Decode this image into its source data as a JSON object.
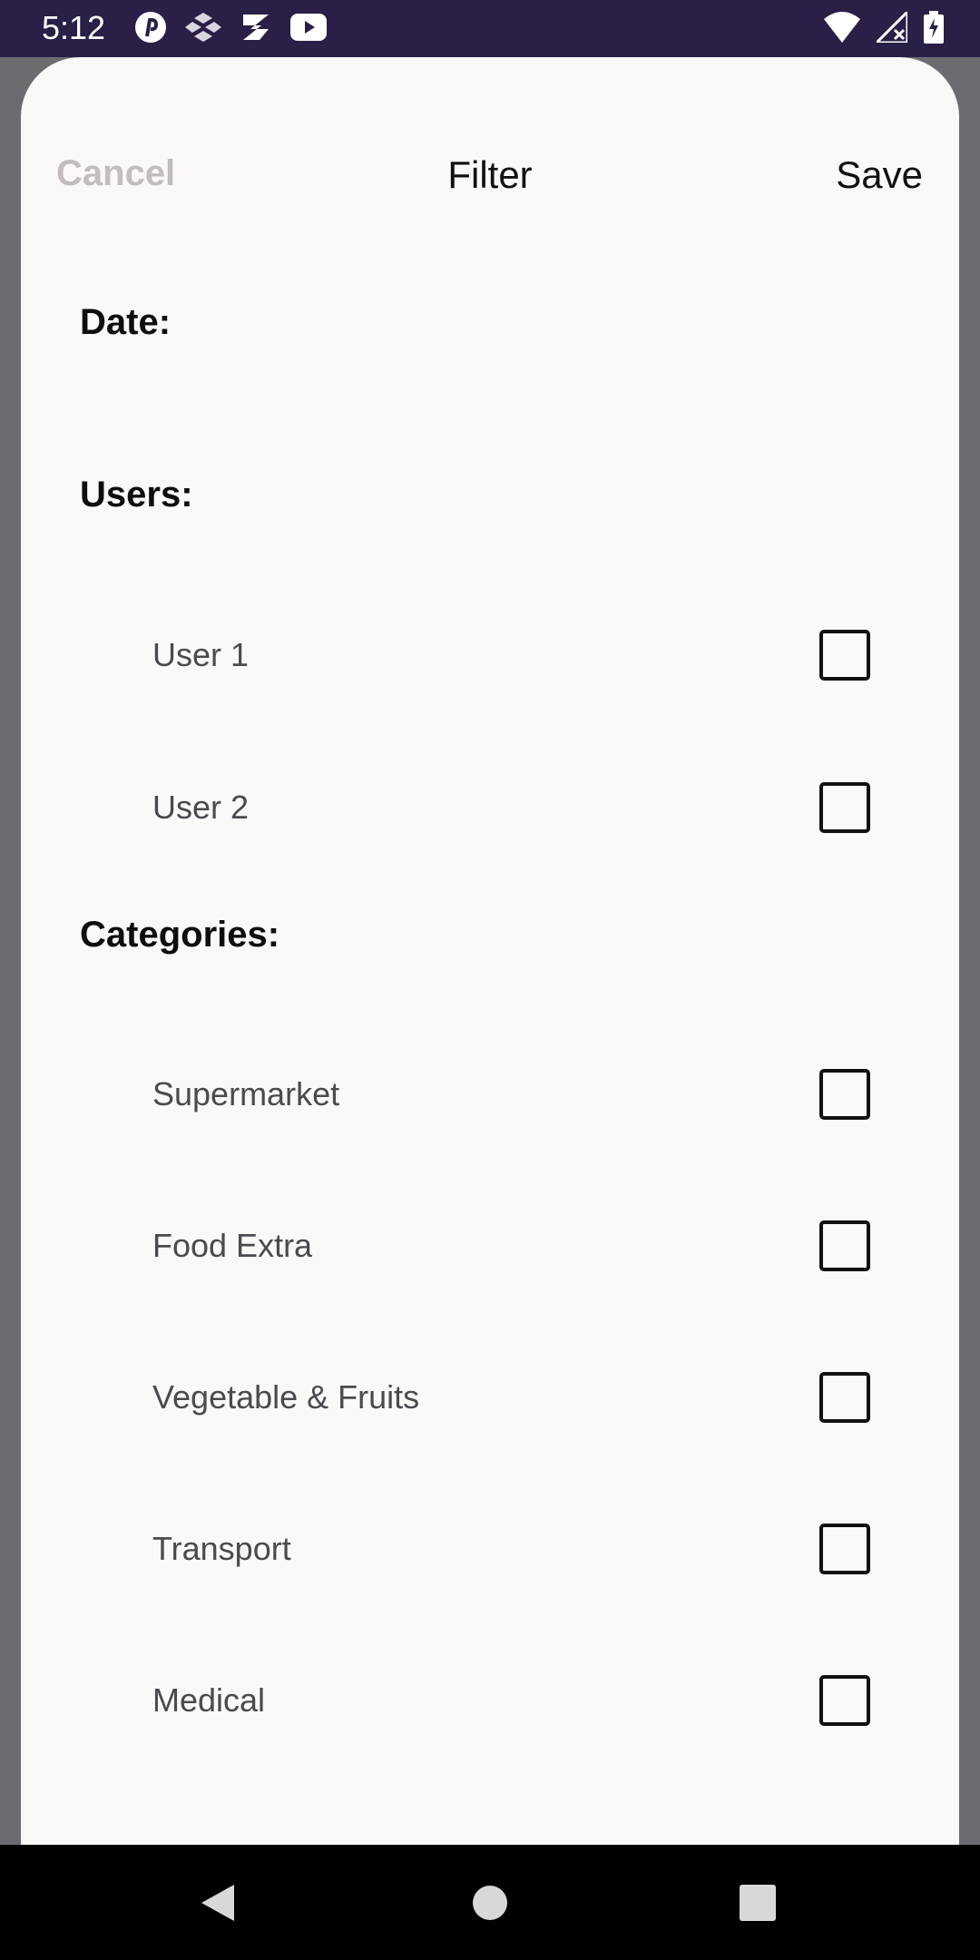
{
  "status_bar": {
    "time": "5:12",
    "left_icons": [
      "pinterest-icon",
      "cube-app-icon",
      "s-app-icon",
      "youtube-icon"
    ],
    "right_icons": [
      "wifi-icon",
      "signal-icon",
      "battery-icon"
    ]
  },
  "header": {
    "cancel_label": "Cancel",
    "title": "Filter",
    "save_label": "Save"
  },
  "sections": {
    "date_label": "Date:",
    "users_label": "Users:",
    "categories_label": "Categories:"
  },
  "users": [
    {
      "label": "User 1",
      "checked": false
    },
    {
      "label": "User 2",
      "checked": false
    }
  ],
  "categories": [
    {
      "label": "Supermarket",
      "checked": false
    },
    {
      "label": "Food Extra",
      "checked": false
    },
    {
      "label": "Vegetable & Fruits",
      "checked": false
    },
    {
      "label": "Transport",
      "checked": false
    },
    {
      "label": "Medical",
      "checked": false
    }
  ],
  "nav_bar": {
    "icons": [
      "back-icon",
      "home-icon",
      "recents-icon"
    ]
  },
  "colors": {
    "status_bar_bg": "#2a1f47",
    "sheet_bg": "#faf9f7",
    "scrim": "#6d6b70",
    "cancel_disabled": "#c3bdbc"
  }
}
